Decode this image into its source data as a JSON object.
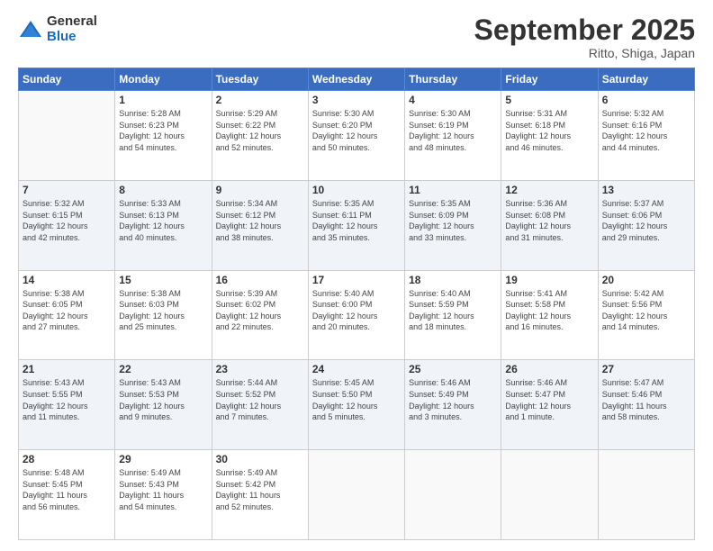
{
  "logo": {
    "line1": "General",
    "line2": "Blue"
  },
  "title": "September 2025",
  "subtitle": "Ritto, Shiga, Japan",
  "days_of_week": [
    "Sunday",
    "Monday",
    "Tuesday",
    "Wednesday",
    "Thursday",
    "Friday",
    "Saturday"
  ],
  "weeks": [
    [
      {
        "day": "",
        "info": ""
      },
      {
        "day": "1",
        "info": "Sunrise: 5:28 AM\nSunset: 6:23 PM\nDaylight: 12 hours\nand 54 minutes."
      },
      {
        "day": "2",
        "info": "Sunrise: 5:29 AM\nSunset: 6:22 PM\nDaylight: 12 hours\nand 52 minutes."
      },
      {
        "day": "3",
        "info": "Sunrise: 5:30 AM\nSunset: 6:20 PM\nDaylight: 12 hours\nand 50 minutes."
      },
      {
        "day": "4",
        "info": "Sunrise: 5:30 AM\nSunset: 6:19 PM\nDaylight: 12 hours\nand 48 minutes."
      },
      {
        "day": "5",
        "info": "Sunrise: 5:31 AM\nSunset: 6:18 PM\nDaylight: 12 hours\nand 46 minutes."
      },
      {
        "day": "6",
        "info": "Sunrise: 5:32 AM\nSunset: 6:16 PM\nDaylight: 12 hours\nand 44 minutes."
      }
    ],
    [
      {
        "day": "7",
        "info": "Sunrise: 5:32 AM\nSunset: 6:15 PM\nDaylight: 12 hours\nand 42 minutes."
      },
      {
        "day": "8",
        "info": "Sunrise: 5:33 AM\nSunset: 6:13 PM\nDaylight: 12 hours\nand 40 minutes."
      },
      {
        "day": "9",
        "info": "Sunrise: 5:34 AM\nSunset: 6:12 PM\nDaylight: 12 hours\nand 38 minutes."
      },
      {
        "day": "10",
        "info": "Sunrise: 5:35 AM\nSunset: 6:11 PM\nDaylight: 12 hours\nand 35 minutes."
      },
      {
        "day": "11",
        "info": "Sunrise: 5:35 AM\nSunset: 6:09 PM\nDaylight: 12 hours\nand 33 minutes."
      },
      {
        "day": "12",
        "info": "Sunrise: 5:36 AM\nSunset: 6:08 PM\nDaylight: 12 hours\nand 31 minutes."
      },
      {
        "day": "13",
        "info": "Sunrise: 5:37 AM\nSunset: 6:06 PM\nDaylight: 12 hours\nand 29 minutes."
      }
    ],
    [
      {
        "day": "14",
        "info": "Sunrise: 5:38 AM\nSunset: 6:05 PM\nDaylight: 12 hours\nand 27 minutes."
      },
      {
        "day": "15",
        "info": "Sunrise: 5:38 AM\nSunset: 6:03 PM\nDaylight: 12 hours\nand 25 minutes."
      },
      {
        "day": "16",
        "info": "Sunrise: 5:39 AM\nSunset: 6:02 PM\nDaylight: 12 hours\nand 22 minutes."
      },
      {
        "day": "17",
        "info": "Sunrise: 5:40 AM\nSunset: 6:00 PM\nDaylight: 12 hours\nand 20 minutes."
      },
      {
        "day": "18",
        "info": "Sunrise: 5:40 AM\nSunset: 5:59 PM\nDaylight: 12 hours\nand 18 minutes."
      },
      {
        "day": "19",
        "info": "Sunrise: 5:41 AM\nSunset: 5:58 PM\nDaylight: 12 hours\nand 16 minutes."
      },
      {
        "day": "20",
        "info": "Sunrise: 5:42 AM\nSunset: 5:56 PM\nDaylight: 12 hours\nand 14 minutes."
      }
    ],
    [
      {
        "day": "21",
        "info": "Sunrise: 5:43 AM\nSunset: 5:55 PM\nDaylight: 12 hours\nand 11 minutes."
      },
      {
        "day": "22",
        "info": "Sunrise: 5:43 AM\nSunset: 5:53 PM\nDaylight: 12 hours\nand 9 minutes."
      },
      {
        "day": "23",
        "info": "Sunrise: 5:44 AM\nSunset: 5:52 PM\nDaylight: 12 hours\nand 7 minutes."
      },
      {
        "day": "24",
        "info": "Sunrise: 5:45 AM\nSunset: 5:50 PM\nDaylight: 12 hours\nand 5 minutes."
      },
      {
        "day": "25",
        "info": "Sunrise: 5:46 AM\nSunset: 5:49 PM\nDaylight: 12 hours\nand 3 minutes."
      },
      {
        "day": "26",
        "info": "Sunrise: 5:46 AM\nSunset: 5:47 PM\nDaylight: 12 hours\nand 1 minute."
      },
      {
        "day": "27",
        "info": "Sunrise: 5:47 AM\nSunset: 5:46 PM\nDaylight: 11 hours\nand 58 minutes."
      }
    ],
    [
      {
        "day": "28",
        "info": "Sunrise: 5:48 AM\nSunset: 5:45 PM\nDaylight: 11 hours\nand 56 minutes."
      },
      {
        "day": "29",
        "info": "Sunrise: 5:49 AM\nSunset: 5:43 PM\nDaylight: 11 hours\nand 54 minutes."
      },
      {
        "day": "30",
        "info": "Sunrise: 5:49 AM\nSunset: 5:42 PM\nDaylight: 11 hours\nand 52 minutes."
      },
      {
        "day": "",
        "info": ""
      },
      {
        "day": "",
        "info": ""
      },
      {
        "day": "",
        "info": ""
      },
      {
        "day": "",
        "info": ""
      }
    ]
  ]
}
